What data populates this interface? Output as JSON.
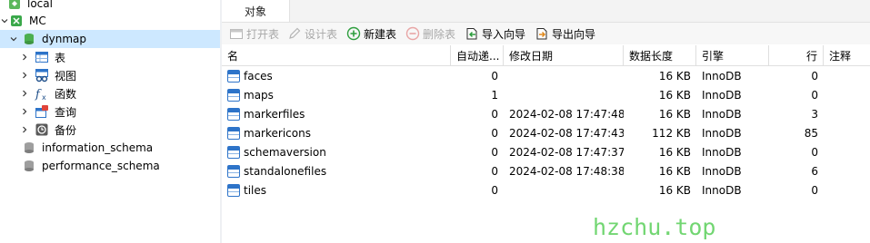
{
  "tree": {
    "items": [
      {
        "label": "local",
        "icon": "connection-icon"
      },
      {
        "label": "MC",
        "icon": "connection-icon"
      },
      {
        "label": "dynmap",
        "icon": "database-icon"
      },
      {
        "label": "表",
        "icon": "tables-icon"
      },
      {
        "label": "视图",
        "icon": "views-icon"
      },
      {
        "label": "函数",
        "icon": "functions-icon"
      },
      {
        "label": "查询",
        "icon": "queries-icon"
      },
      {
        "label": "备份",
        "icon": "backups-icon"
      },
      {
        "label": "information_schema",
        "icon": "database-icon"
      },
      {
        "label": "performance_schema",
        "icon": "database-icon"
      }
    ]
  },
  "tabs": {
    "objects_label": "对象"
  },
  "toolbar": {
    "open_table": "打开表",
    "design_table": "设计表",
    "new_table": "新建表",
    "delete_table": "删除表",
    "import_wizard": "导入向导",
    "export_wizard": "导出向导"
  },
  "grid": {
    "columns": {
      "name": "名",
      "auto_increment": "自动递...",
      "modified": "修改日期",
      "data_length": "数据长度",
      "engine": "引擎",
      "rows": "行",
      "comment": "注释"
    },
    "rows": [
      {
        "name": "faces",
        "auto_increment": "0",
        "modified": "",
        "data_length": "16 KB",
        "engine": "InnoDB",
        "rows": "0"
      },
      {
        "name": "maps",
        "auto_increment": "1",
        "modified": "",
        "data_length": "16 KB",
        "engine": "InnoDB",
        "rows": "0"
      },
      {
        "name": "markerfiles",
        "auto_increment": "0",
        "modified": "2024-02-08 17:47:48",
        "data_length": "16 KB",
        "engine": "InnoDB",
        "rows": "3"
      },
      {
        "name": "markericons",
        "auto_increment": "0",
        "modified": "2024-02-08 17:47:43",
        "data_length": "112 KB",
        "engine": "InnoDB",
        "rows": "85"
      },
      {
        "name": "schemaversion",
        "auto_increment": "0",
        "modified": "2024-02-08 17:47:37",
        "data_length": "16 KB",
        "engine": "InnoDB",
        "rows": "0"
      },
      {
        "name": "standalonefiles",
        "auto_increment": "0",
        "modified": "2024-02-08 17:48:38",
        "data_length": "16 KB",
        "engine": "InnoDB",
        "rows": "6"
      },
      {
        "name": "tiles",
        "auto_increment": "0",
        "modified": "",
        "data_length": "16 KB",
        "engine": "InnoDB",
        "rows": "0"
      }
    ]
  },
  "watermark": "hzchu.top",
  "colors": {
    "selection": "#cde8ff",
    "accent": "#2e74c9",
    "watermark": "#72d672"
  }
}
